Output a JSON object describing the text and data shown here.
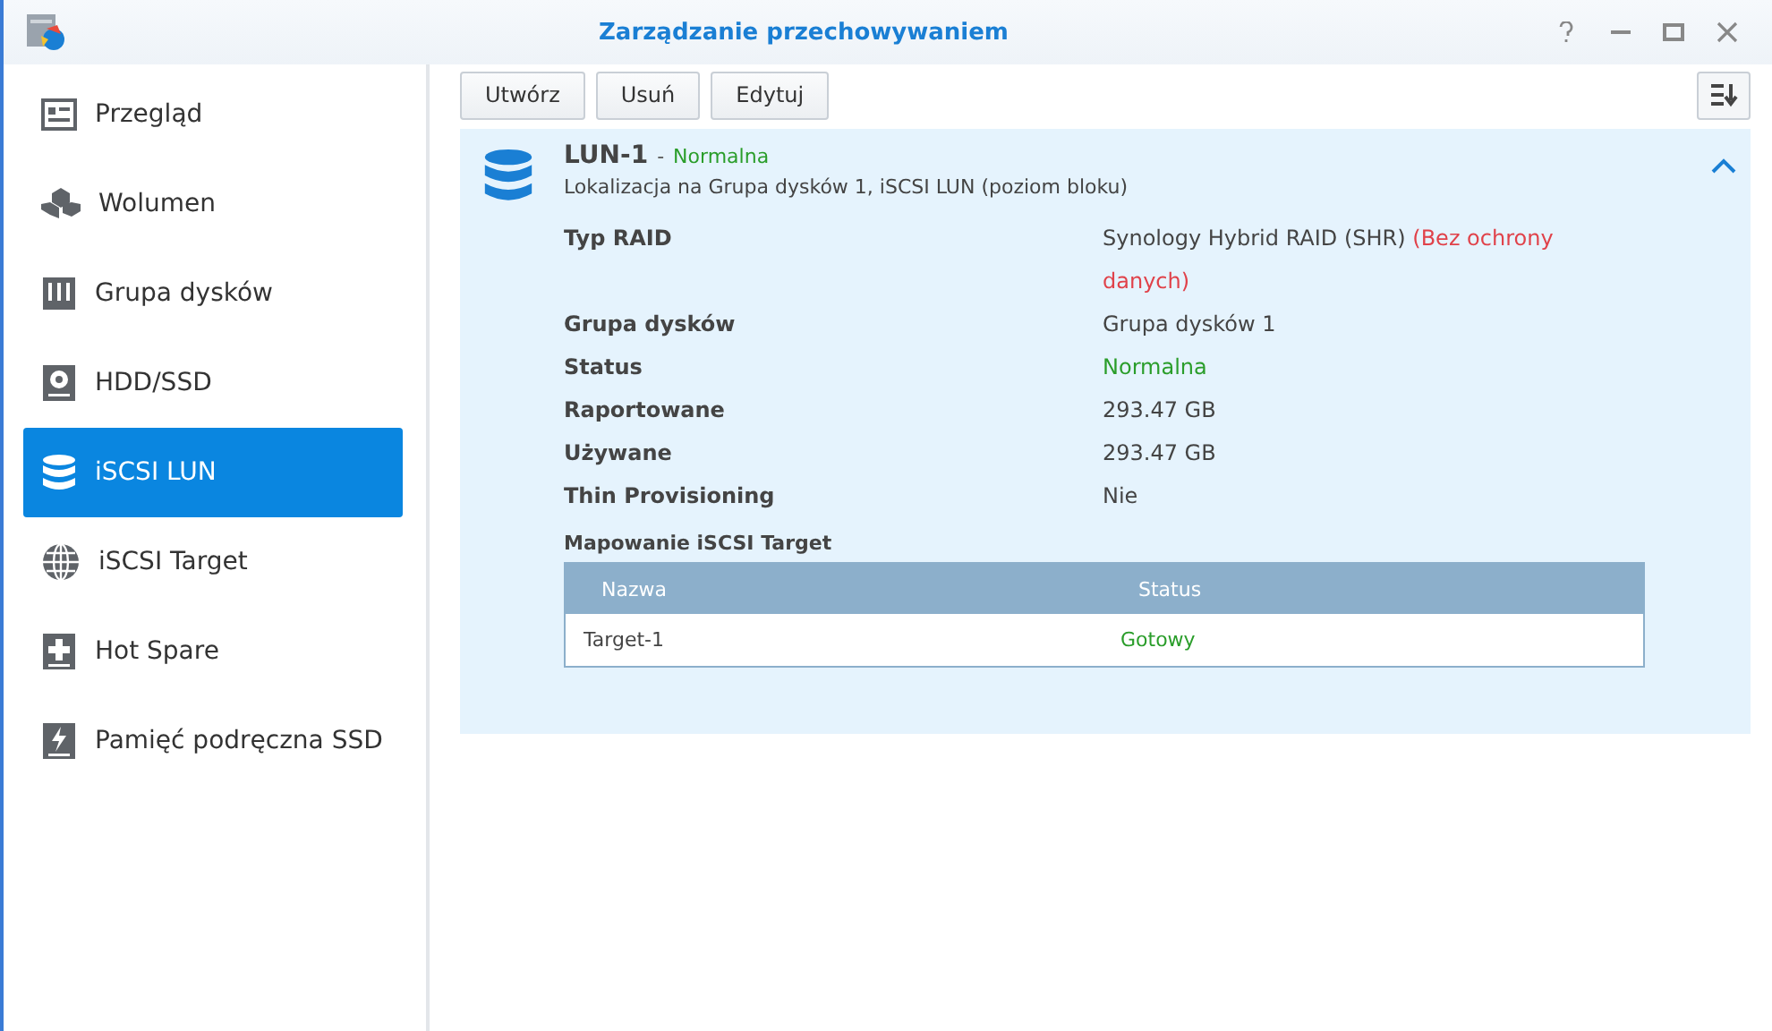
{
  "window": {
    "title": "Zarządzanie przechowywaniem"
  },
  "sidebar": {
    "items": [
      {
        "label": "Przegląd",
        "selected": false
      },
      {
        "label": "Wolumen",
        "selected": false
      },
      {
        "label": "Grupa dysków",
        "selected": false
      },
      {
        "label": "HDD/SSD",
        "selected": false
      },
      {
        "label": "iSCSI LUN",
        "selected": true
      },
      {
        "label": "iSCSI Target",
        "selected": false
      },
      {
        "label": "Hot Spare",
        "selected": false
      },
      {
        "label": "Pamięć podręczna SSD",
        "selected": false
      }
    ]
  },
  "toolbar": {
    "buttons": [
      "Utwórz",
      "Usuń",
      "Edytuj"
    ]
  },
  "lun": {
    "name": "LUN-1",
    "separator": "-",
    "status": "Normalna",
    "location": "Lokalizacja na Grupa dysków 1, iSCSI LUN (poziom bloku)",
    "expanded": true,
    "details": [
      {
        "label": "Typ RAID",
        "value": "Synology Hybrid RAID (SHR)",
        "note": "(Bez ochrony danych)",
        "color": "#444444"
      },
      {
        "label": "Grupa dysków",
        "value": "Grupa dysków 1",
        "color": "#444444"
      },
      {
        "label": "Status",
        "value": "Normalna",
        "color": "#2a9d2a"
      },
      {
        "label": "Raportowane",
        "value": "293.47 GB",
        "color": "#444444"
      },
      {
        "label": "Używane",
        "value": "293.47 GB",
        "color": "#444444"
      },
      {
        "label": "Thin Provisioning",
        "value": "Nie",
        "color": "#444444"
      }
    ],
    "mapping": {
      "title": "Mapowanie iSCSI Target",
      "columns": [
        "Nazwa",
        "Status"
      ],
      "rows": [
        {
          "name": "Target-1",
          "status": "Gotowy",
          "color": "#2a9d2a"
        }
      ]
    }
  }
}
